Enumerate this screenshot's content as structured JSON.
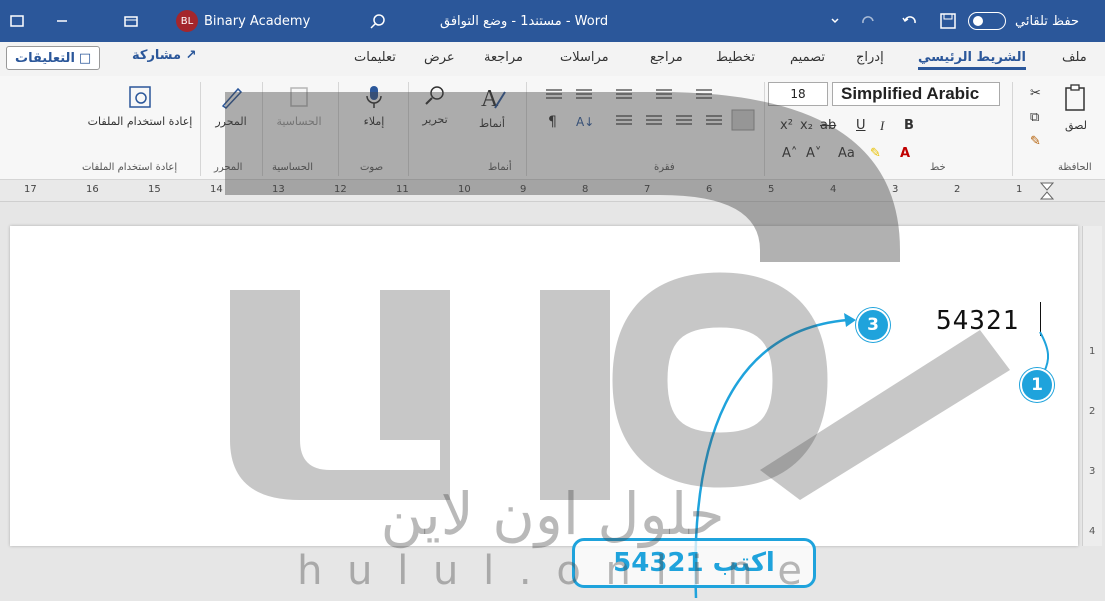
{
  "titlebar": {
    "autosave_label": "حفظ تلقائي",
    "doc_title": "مستند1 - وضع التوافق - Word",
    "user_initials": "BL",
    "user_name": "Binary Academy"
  },
  "tabs": {
    "items": [
      "ملف",
      "الشريط الرئيسي",
      "إدراج",
      "تصميم",
      "تخطيط",
      "مراجع",
      "مراسلات",
      "مراجعة",
      "عرض",
      "تعليمات"
    ],
    "active": "الشريط الرئيسي",
    "share_label": "مشاركة",
    "comments_label": "التعليقات"
  },
  "ribbon": {
    "paste_label": "لصق",
    "clipboard_label": "الحافظة",
    "font_name": "Simplified Arabic",
    "font_size": "18",
    "font_group_label": "خط",
    "paragraph_group_label": "فقرة",
    "styles_label": "أنماط",
    "styles_group_label": "أنماط",
    "editing_label": "تحرير",
    "dictate_label": "إملاء",
    "voice_group_label": "صوت",
    "sensitivity_label": "الحساسية",
    "sensitivity_group_label": "الحساسية",
    "editor_label": "المحرر",
    "editor_group_label": "المحرر",
    "reuse_files_label": "إعادة استخدام الملفات",
    "reuse_files_group_label": "إعادة استخدام الملفات"
  },
  "ruler": {
    "numbers": [
      "17",
      "16",
      "15",
      "14",
      "13",
      "12",
      "11",
      "10",
      "9",
      "8",
      "7",
      "6",
      "5",
      "4",
      "3",
      "2",
      "1"
    ]
  },
  "vruler": {
    "numbers": [
      "1",
      "2",
      "3",
      "4"
    ]
  },
  "document": {
    "text": "54321"
  },
  "callouts": {
    "badge_1": "1",
    "badge_3": "3",
    "instruction": "اكتب 54321"
  },
  "watermark": {
    "line1": "حلول اون لاين",
    "line2": "h u l u l . o n l i n e"
  },
  "colors": {
    "word_blue": "#2b579a",
    "callout_blue": "#1fa3dc"
  }
}
